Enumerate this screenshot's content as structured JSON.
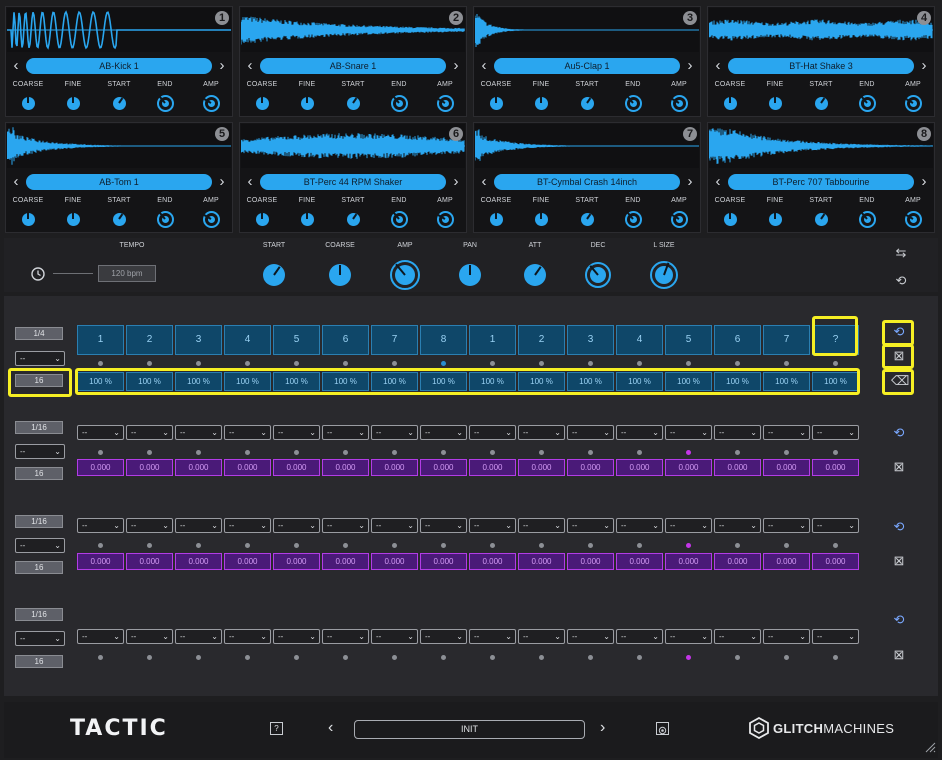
{
  "samples": [
    {
      "num": "1",
      "name": "AB-Kick 1",
      "wave": "kick"
    },
    {
      "num": "2",
      "name": "AB-Snare 1",
      "wave": "snare"
    },
    {
      "num": "3",
      "name": "Au5-Clap 1",
      "wave": "clap"
    },
    {
      "num": "4",
      "name": "BT-Hat Shake 3",
      "wave": "hat"
    },
    {
      "num": "5",
      "name": "AB-Tom 1",
      "wave": "tom"
    },
    {
      "num": "6",
      "name": "BT-Perc 44 RPM Shaker",
      "wave": "shaker"
    },
    {
      "num": "7",
      "name": "BT-Cymbal Crash 14inch",
      "wave": "crash"
    },
    {
      "num": "8",
      "name": "BT-Perc 707 Tabbourine",
      "wave": "tamb"
    }
  ],
  "knob_labels": [
    "COARSE",
    "FINE",
    "START",
    "END",
    "AMP"
  ],
  "global": {
    "tempo_label": "TEMPO",
    "tempo_value": "120 bpm",
    "knobs": [
      "START",
      "COARSE",
      "AMP",
      "PAN",
      "ATT",
      "DEC",
      "L SIZE"
    ]
  },
  "lanes": [
    {
      "rate": "1/4",
      "division": "--",
      "length": "16"
    },
    {
      "rate": "1/16",
      "division": "--",
      "length": "16"
    },
    {
      "rate": "1/16",
      "division": "--",
      "length": "16"
    },
    {
      "rate": "1/16",
      "division": "--",
      "length": "16"
    }
  ],
  "lane1_steps": [
    "1",
    "2",
    "3",
    "4",
    "5",
    "6",
    "7",
    "8",
    "1",
    "2",
    "3",
    "4",
    "5",
    "6",
    "7",
    "?"
  ],
  "lane1_pct": [
    "100 %",
    "100 %",
    "100 %",
    "100 %",
    "100 %",
    "100 %",
    "100 %",
    "100 %",
    "100 %",
    "100 %",
    "100 %",
    "100 %",
    "100 %",
    "100 %",
    "100 %",
    "100 %"
  ],
  "step_select": "--",
  "step_value": "0.000",
  "footer": {
    "logo": "TACTIC",
    "help": "?",
    "preset": "INIT",
    "brand_bold": "GLITCH",
    "brand_light": "MACHINES"
  },
  "colors": {
    "accent": "#2aa6ef",
    "purple": "#b23ce6",
    "highlight": "#f6ef24"
  }
}
